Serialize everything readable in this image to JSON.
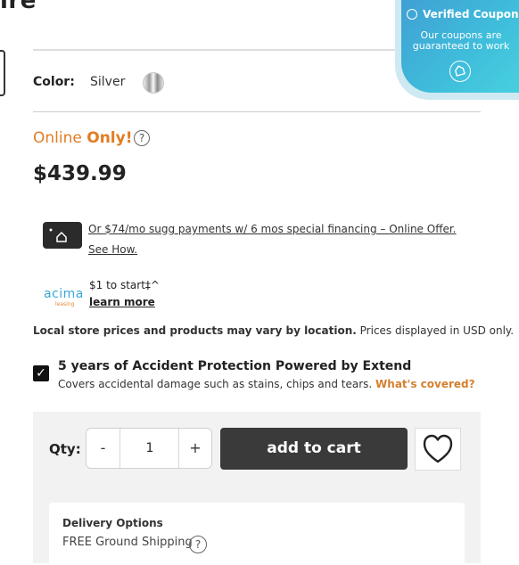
{
  "product": {
    "title_fragment": "ire"
  },
  "color": {
    "label": "Color:",
    "value": "Silver"
  },
  "coupon": {
    "title": "Verified Coupon",
    "subtitle": "Our coupons are guaranteed to work"
  },
  "availability": {
    "prefix": "Online",
    "emphasis": "Only!"
  },
  "price": "$439.99",
  "financing": {
    "text": "Or $74/mo sugg payments w/ 6 mos special financing – Online Offer. See How."
  },
  "acima": {
    "logo": "acima",
    "sublogo": "leasing",
    "line1": "$1 to start‡^",
    "learn_more": "learn more"
  },
  "disclaimer": {
    "bold": "Local store prices and products may vary by location.",
    "rest": " Prices displayed in USD only."
  },
  "protection": {
    "title": "5 years of Accident Protection Powered by Extend",
    "desc": "Covers accidental damage such as stains, chips and tears.",
    "link": "What's covered?"
  },
  "cart": {
    "qty_label": "Qty:",
    "minus": "-",
    "qty": "1",
    "plus": "+",
    "add_to_cart": "add to cart"
  },
  "delivery": {
    "title": "Delivery Options",
    "shipping": "FREE Ground Shipping"
  },
  "icons": {
    "help": "question-circle-icon",
    "financing": "card-icon",
    "wish": "heart-icon",
    "coupon_check": "check-circle-icon",
    "coupon_badge": "shield-icon",
    "checkbox": "checkbox-checked-icon"
  },
  "colors": {
    "accent_orange": "#e27d24",
    "coupon_blue": "#3fb5da",
    "button_dark": "#3a3a3a"
  }
}
